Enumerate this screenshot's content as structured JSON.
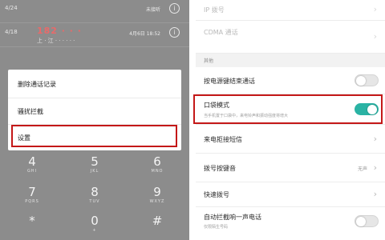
{
  "left": {
    "calls": [
      {
        "date": "4/24",
        "name": "",
        "sub": "",
        "meta": "未接听",
        "info_icon": "info-icon"
      },
      {
        "date": "4/18",
        "name": "182 · · ·",
        "sub": "上 · 江 · · · · · ·",
        "meta": "4月6日 18:52",
        "info_icon": "info-icon"
      }
    ],
    "menu": {
      "items": [
        "删除通话记录",
        "骚扰拦截",
        "设置"
      ]
    },
    "keypad": [
      {
        "num": "4",
        "sub": "GHI"
      },
      {
        "num": "5",
        "sub": "JKL"
      },
      {
        "num": "6",
        "sub": "MNO"
      },
      {
        "num": "7",
        "sub": "PQRS"
      },
      {
        "num": "8",
        "sub": "TUV"
      },
      {
        "num": "9",
        "sub": "WXYZ"
      },
      {
        "num": "*",
        "sub": ""
      },
      {
        "num": "0",
        "sub": "+"
      },
      {
        "num": "#",
        "sub": ""
      }
    ]
  },
  "right": {
    "top_rows": [
      {
        "title": "IP 拨号"
      },
      {
        "title": "CDMA 通话",
        "desc": ""
      }
    ],
    "section_label": "其他",
    "rows": [
      {
        "title": "按电源键结束通话",
        "control": "toggle",
        "on": false
      },
      {
        "title": "口袋模式",
        "desc": "当手机置于口袋中，来电铃声和振动强度将增大",
        "control": "toggle",
        "on": true
      },
      {
        "title": "来电拒接短信",
        "control": "chevron"
      },
      {
        "title": "拨号按键音",
        "value": "无声",
        "control": "chevron"
      },
      {
        "title": "快速拨号",
        "control": "chevron"
      },
      {
        "title": "自动拦截响一声电话",
        "desc": "仅限陌生号码",
        "control": "toggle",
        "on": false
      }
    ],
    "accent_color": "#2ab3a4"
  }
}
